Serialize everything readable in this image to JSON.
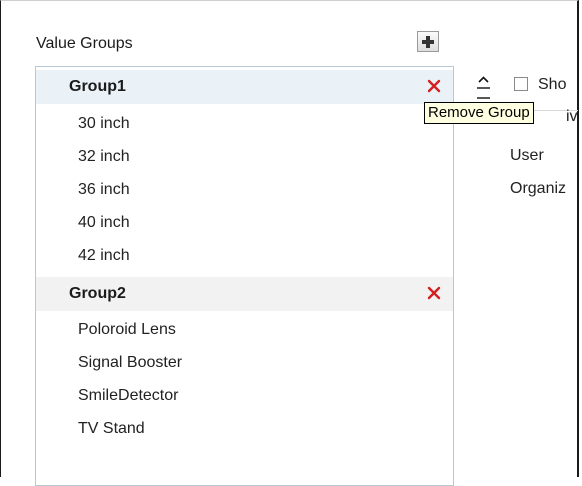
{
  "value_groups": {
    "title": "Value Groups",
    "groups": [
      {
        "name": "Group1",
        "items": [
          "30 inch",
          "32 inch",
          "36 inch",
          "40 inch",
          "42 inch"
        ]
      },
      {
        "name": "Group2",
        "items": [
          "Poloroid Lens",
          "Signal Booster",
          "SmileDetector",
          "TV Stand"
        ]
      }
    ]
  },
  "icons": {
    "add_group": "plus-icon",
    "remove_group": "red-x-icon",
    "move_up": "caret-up-icon",
    "move_down": "caret-down-icon"
  },
  "colors": {
    "remove_x": "#d42020",
    "group1_bg": "#eaf1f7",
    "group2_bg": "#f2f2f2",
    "tooltip_bg": "#ffffe1"
  },
  "right_panel": {
    "show_label": "Sho",
    "partial_option_suffix": "iv",
    "options": [
      "User",
      "Organiz"
    ]
  },
  "tooltip": {
    "text": "Remove Group"
  }
}
